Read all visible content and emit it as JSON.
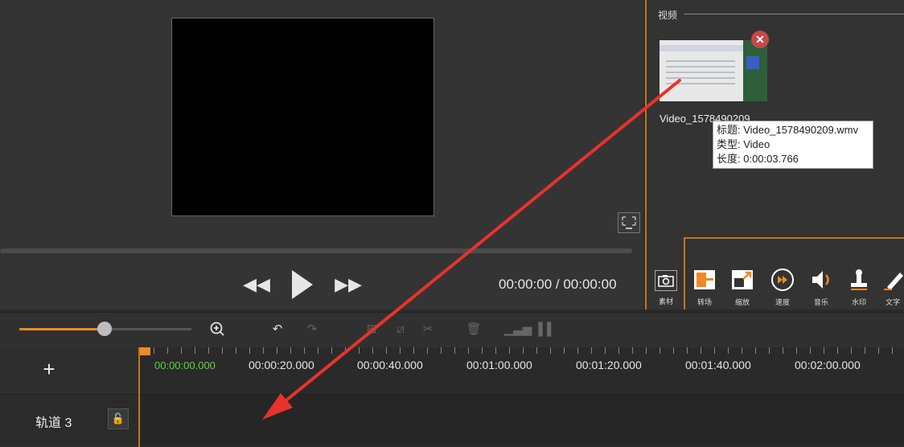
{
  "media_panel": {
    "section_label": "视频",
    "thumbnail_name": "Video_1578490209",
    "tooltip": {
      "title": "标题: Video_1578490209.wmv",
      "type": "类型: Video",
      "length": "长度: 0:00:03.766"
    }
  },
  "player": {
    "timecode": "00:00:00 / 00:00:00"
  },
  "tools": [
    {
      "label": "素材",
      "icon": "camera-icon"
    },
    {
      "label": "转场",
      "icon": "transition-icon"
    },
    {
      "label": "缩放",
      "icon": "zoom-effect-icon"
    },
    {
      "label": "速度",
      "icon": "speed-icon"
    },
    {
      "label": "音乐",
      "icon": "speaker-icon"
    },
    {
      "label": "水印",
      "icon": "stamp-icon"
    },
    {
      "label": "文字",
      "icon": "text-pen-icon"
    }
  ],
  "timeline": {
    "start": "00:00:00.000",
    "ticks": [
      "00:00:20.000",
      "00:00:40.000",
      "00:01:00.000",
      "00:01:20.000",
      "00:01:40.000",
      "00:02:00.000"
    ],
    "tracks": [
      {
        "name": "轨道 3"
      }
    ]
  },
  "colors": {
    "accent": "#c4741e",
    "zoom_fill": "#f08a24",
    "timecode_green": "#5ad33a",
    "annotation_arrow": "#e8322c"
  }
}
